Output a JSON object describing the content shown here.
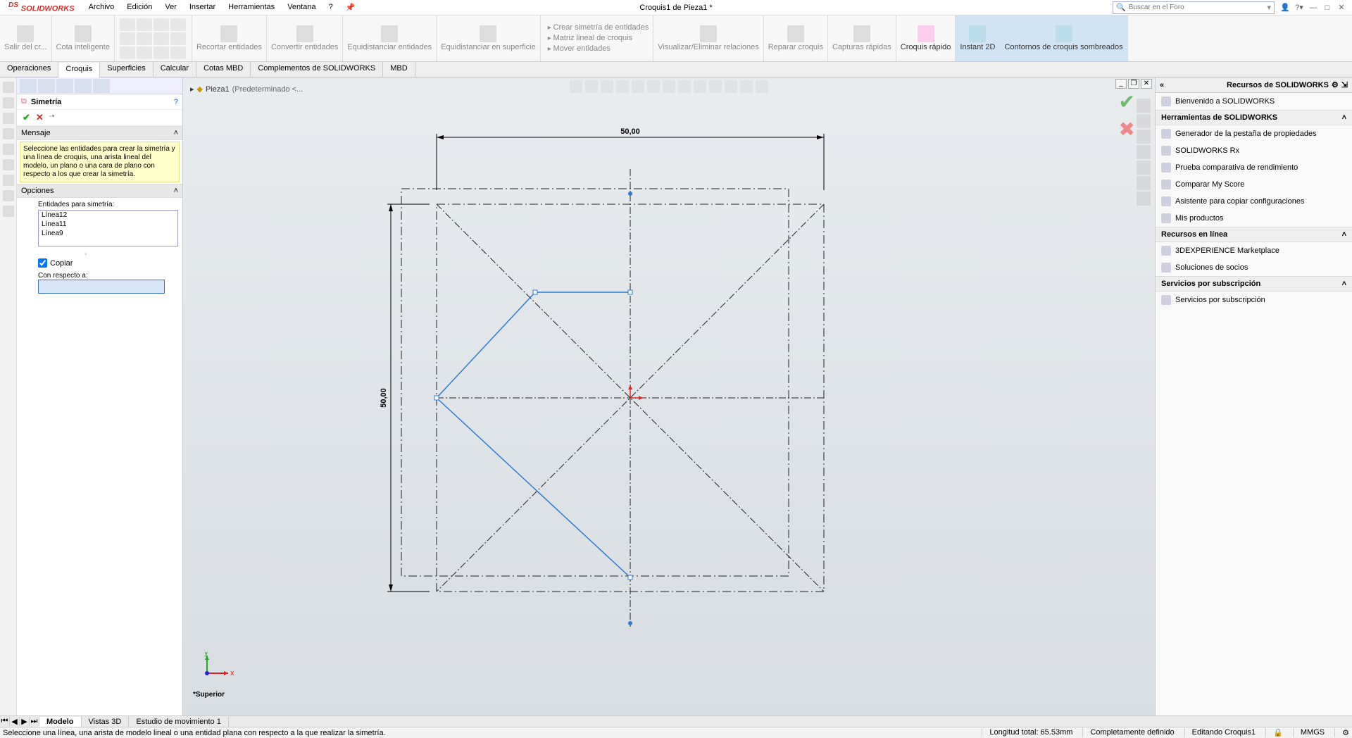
{
  "app": {
    "brand": "SOLIDWORKS",
    "title": "Croquis1 de Pieza1 *"
  },
  "menu": [
    "Archivo",
    "Edición",
    "Ver",
    "Insertar",
    "Herramientas",
    "Ventana",
    "?"
  ],
  "search": {
    "placeholder": "Buscar en el Foro"
  },
  "ribbon_tabs": [
    "Operaciones",
    "Croquis",
    "Superficies",
    "Calcular",
    "Cotas MBD",
    "Complementos de SOLIDWORKS",
    "MBD"
  ],
  "ribbon_active": 1,
  "ribbon": {
    "exit": "Salir del cr...",
    "smart_dim": "Cota inteligente",
    "trim": "Recortar entidades",
    "convert": "Convertir entidades",
    "offset": "Equidistanciar entidades",
    "offset_surf": "Equidistanciar en superficie",
    "mirror": "Crear simetría de entidades",
    "pattern": "Matriz lineal de croquis",
    "move": "Mover entidades",
    "show_rel": "Visualizar/Eliminar relaciones",
    "repair": "Reparar croquis",
    "quick_snap": "Capturas rápidas",
    "rapid": "Croquis rápido",
    "instant2d": "Instant 2D",
    "shaded": "Contornos de croquis sombreados"
  },
  "breadcrumb": {
    "part": "Pieza1",
    "state": "(Predeterminado <..."
  },
  "prop": {
    "title": "Simetría",
    "msg_h": "Mensaje",
    "msg": "Seleccione las entidades para crear la simetría y una línea de croquis, una arista lineal del modelo, un plano o una cara de plano con respecto a los que crear la simetría.",
    "opts_h": "Opciones",
    "entities_label": "Entidades para simetría:",
    "entities": [
      "Línea12",
      "Línea11",
      "Línea9"
    ],
    "copy": "Copiar",
    "respect": "Con respecto a:"
  },
  "dims": {
    "width": "50,00",
    "height": "50,00"
  },
  "triad": {
    "x": "x",
    "y": "y",
    "view": "*Superior"
  },
  "bottom_tabs": [
    "Modelo",
    "Vistas 3D",
    "Estudio de movimiento 1"
  ],
  "status": {
    "hint": "Seleccione una línea, una arista de modelo lineal o una entidad plana con respecto a la que realizar la simetría.",
    "length": "Longitud total: 65.53mm",
    "defined": "Completamente definido",
    "editing": "Editando Croquis1",
    "units": "MMGS"
  },
  "taskpane": {
    "title": "Recursos de SOLIDWORKS",
    "welcome": "Bienvenido a SOLIDWORKS",
    "tools_h": "Herramientas de SOLIDWORKS",
    "tools": [
      "Generador de la pestaña de propiedades",
      "SOLIDWORKS Rx",
      "Prueba comparativa de rendimiento",
      "Comparar My Score",
      "Asistente para copiar configuraciones",
      "Mis productos"
    ],
    "online_h": "Recursos en línea",
    "online": [
      "3DEXPERIENCE Marketplace",
      "Soluciones de socios"
    ],
    "sub_h": "Servicios por subscripción",
    "sub": [
      "Servicios por subscripción"
    ]
  }
}
